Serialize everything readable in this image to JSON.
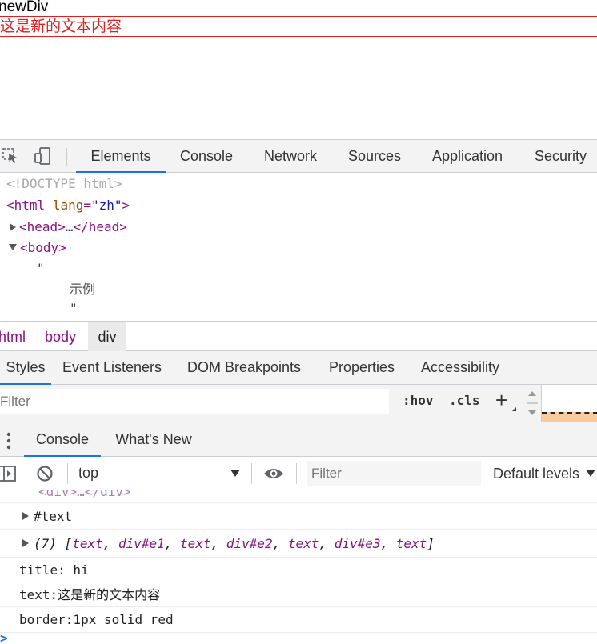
{
  "page": {
    "line1": "newDiv",
    "line2": "这是新的文本内容"
  },
  "devtools": {
    "main_tabs": [
      "Elements",
      "Console",
      "Network",
      "Sources",
      "Application",
      "Security"
    ],
    "dom": {
      "doctype": "<!DOCTYPE html>",
      "html_open_tag": "<html",
      "html_attr_name": "lang",
      "html_attr_eq": "=",
      "html_attr_value": "\"zh\"",
      "html_close_bracket": ">",
      "head_open": "<head>",
      "head_ellipsis": "…",
      "head_close": "</head>",
      "body_open": "<body>",
      "quote_open": "\"",
      "text_node": "示例",
      "quote_close": "\""
    },
    "breadcrumb": [
      "html",
      "body",
      "div"
    ],
    "side_tabs": [
      "Styles",
      "Event Listeners",
      "DOM Breakpoints",
      "Properties",
      "Accessibility"
    ],
    "styles_filter": {
      "placeholder": "Filter",
      "hov": ":hov",
      "cls": ".cls",
      "plus": "+"
    },
    "drawer_tabs": [
      "Console",
      "What's New"
    ],
    "console_toolbar": {
      "context": "top",
      "filter_placeholder": "Filter",
      "levels": "Default levels"
    },
    "console_lines": {
      "cut_line": "<div>…</div>",
      "text_node": "#text",
      "array_count": "(7)",
      "array_open": "[",
      "array_items": [
        {
          "text": "text",
          "sep": ", "
        },
        {
          "text": "div#e1",
          "sep": ", "
        },
        {
          "text": "text",
          "sep": ", "
        },
        {
          "text": "div#e2",
          "sep": ", "
        },
        {
          "text": "text",
          "sep": ", "
        },
        {
          "text": "div#e3",
          "sep": ", "
        },
        {
          "text": "text",
          "sep": ""
        }
      ],
      "array_close": "]",
      "log1": "title: hi",
      "log2": "text:这是新的文本内容",
      "log3": "border:1px solid red",
      "prompt": ">"
    }
  },
  "colors": {
    "accent": "#1a73e8",
    "tag": "#881280",
    "attr": "#994500",
    "value": "#1a1aa6",
    "red": "#e02020"
  }
}
